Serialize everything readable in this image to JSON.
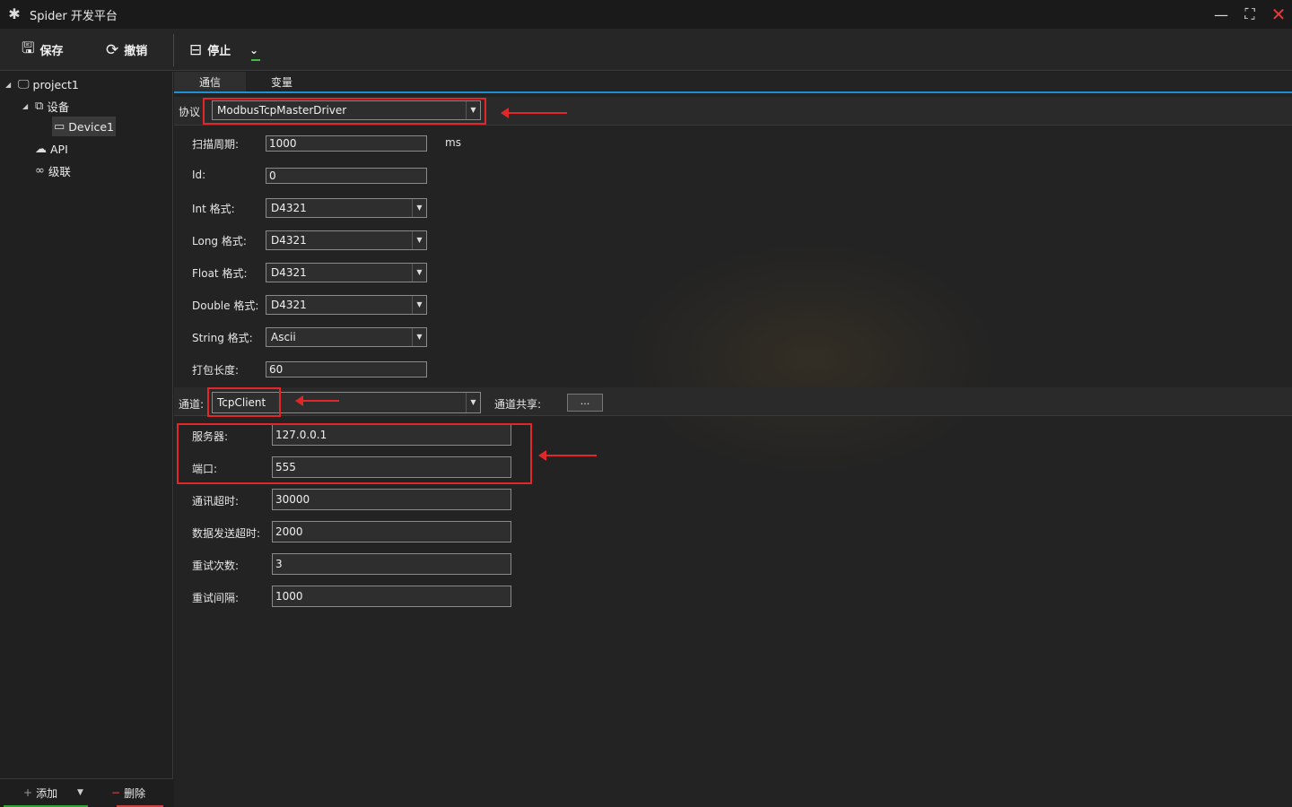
{
  "window": {
    "title": "Spider 开发平台",
    "logo_icon": "spider-icon"
  },
  "toolbar": {
    "save_label": "保存",
    "undo_label": "撤销",
    "stop_label": "停止"
  },
  "tree": {
    "project": "project1",
    "devices": "设备",
    "device1": "Device1",
    "api": "API",
    "cascade": "级联"
  },
  "left_actions": {
    "add_label": "添加",
    "delete_label": "删除"
  },
  "tabs": [
    "通信",
    "变量"
  ],
  "protocol": {
    "label": "协议",
    "value": "ModbusTcpMasterDriver"
  },
  "driver_settings": {
    "scan_label": "扫描周期:",
    "scan_value": "1000",
    "scan_unit": "ms",
    "id_label": "Id:",
    "id_value": "0",
    "int_label": "Int 格式:",
    "int_value": "D4321",
    "long_label": "Long 格式:",
    "long_value": "D4321",
    "float_label": "Float 格式:",
    "float_value": "D4321",
    "double_label": "Double 格式:",
    "double_value": "D4321",
    "string_label": "String 格式:",
    "string_value": "Ascii",
    "pack_label": "打包长度:",
    "pack_value": "60"
  },
  "channel": {
    "label": "通道:",
    "value": "TcpClient",
    "share_label": "通道共享:",
    "share_button": "..."
  },
  "channel_settings": {
    "server_label": "服务器:",
    "server_value": "127.0.0.1",
    "port_label": "端口:",
    "port_value": "555",
    "comm_timeout_label": "通讯超时:",
    "comm_timeout_value": "30000",
    "send_timeout_label": "数据发送超时:",
    "send_timeout_value": "2000",
    "retry_count_label": "重试次数:",
    "retry_count_value": "3",
    "retry_interval_label": "重试间隔:",
    "retry_interval_value": "1000"
  },
  "colors": {
    "highlight": "#e0282a",
    "tab_accent": "#1e90d6"
  }
}
